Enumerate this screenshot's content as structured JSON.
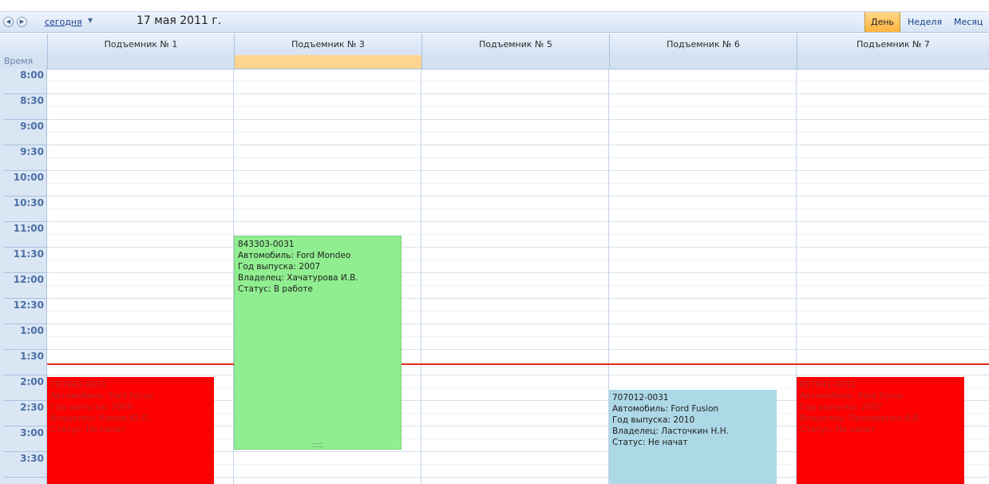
{
  "toolbar": {
    "today_label": "сегодня",
    "date_title": "17 мая 2011 г.",
    "views": [
      {
        "label": "День",
        "active": true
      },
      {
        "label": "Неделя",
        "active": false
      },
      {
        "label": "Месяц",
        "active": false
      }
    ],
    "prev_icon": "chevron-left-icon",
    "next_icon": "chevron-right-icon",
    "dropdown_icon": "chevron-down-icon"
  },
  "scheduler": {
    "time_caption": "Время",
    "resources": [
      "Подъемник № 1",
      "Подъемник № 3",
      "Подъемник № 5",
      "Подъемник № 6",
      "Подъемник № 7"
    ],
    "times": [
      "8:00",
      "8:30",
      "9:00",
      "9:30",
      "10:00",
      "10:30",
      "11:00",
      "11:30",
      "12:00",
      "12:30",
      "1:00",
      "1:30",
      "2:00",
      "2:30",
      "3:00",
      "3:30"
    ],
    "appointments": [
      {
        "resource": "Подъемник № 1",
        "color": "#fd0000",
        "lines": [
          "783943-0031",
          "Автомобиль: Ford Focus",
          "Год выпуска: 2009",
          "Владелец: Камов Ю.Л.",
          "Статус: Не начат"
        ]
      },
      {
        "resource": "Подъемник № 3",
        "color": "#90ee90",
        "lines": [
          "843303-0031",
          "Автомобиль: Ford Mondeo",
          "Год выпуска: 2007",
          "Владелец: Хачатурова И.В.",
          "Статус: В работе"
        ]
      },
      {
        "resource": "Подъемник № 6",
        "color": "#add8e6",
        "lines": [
          "707012-0031",
          "Автомобиль: Ford Fusion",
          "Год выпуска: 2010",
          "Владелец: Ласточкин Н.Н.",
          "Статус: Не начат"
        ]
      },
      {
        "resource": "Подъемник № 7",
        "color": "#fd0000",
        "lines": [
          "657841-0031",
          "Автомобиль: Ford Focus",
          "Год выпуска: 2007",
          "Владелец: Прохоренко А.В.",
          "Статус: Не начат"
        ]
      }
    ]
  },
  "colors": {
    "selected_allday": "#fed590",
    "current_time_line": "#e32b1a",
    "header_text": "#15428b"
  }
}
